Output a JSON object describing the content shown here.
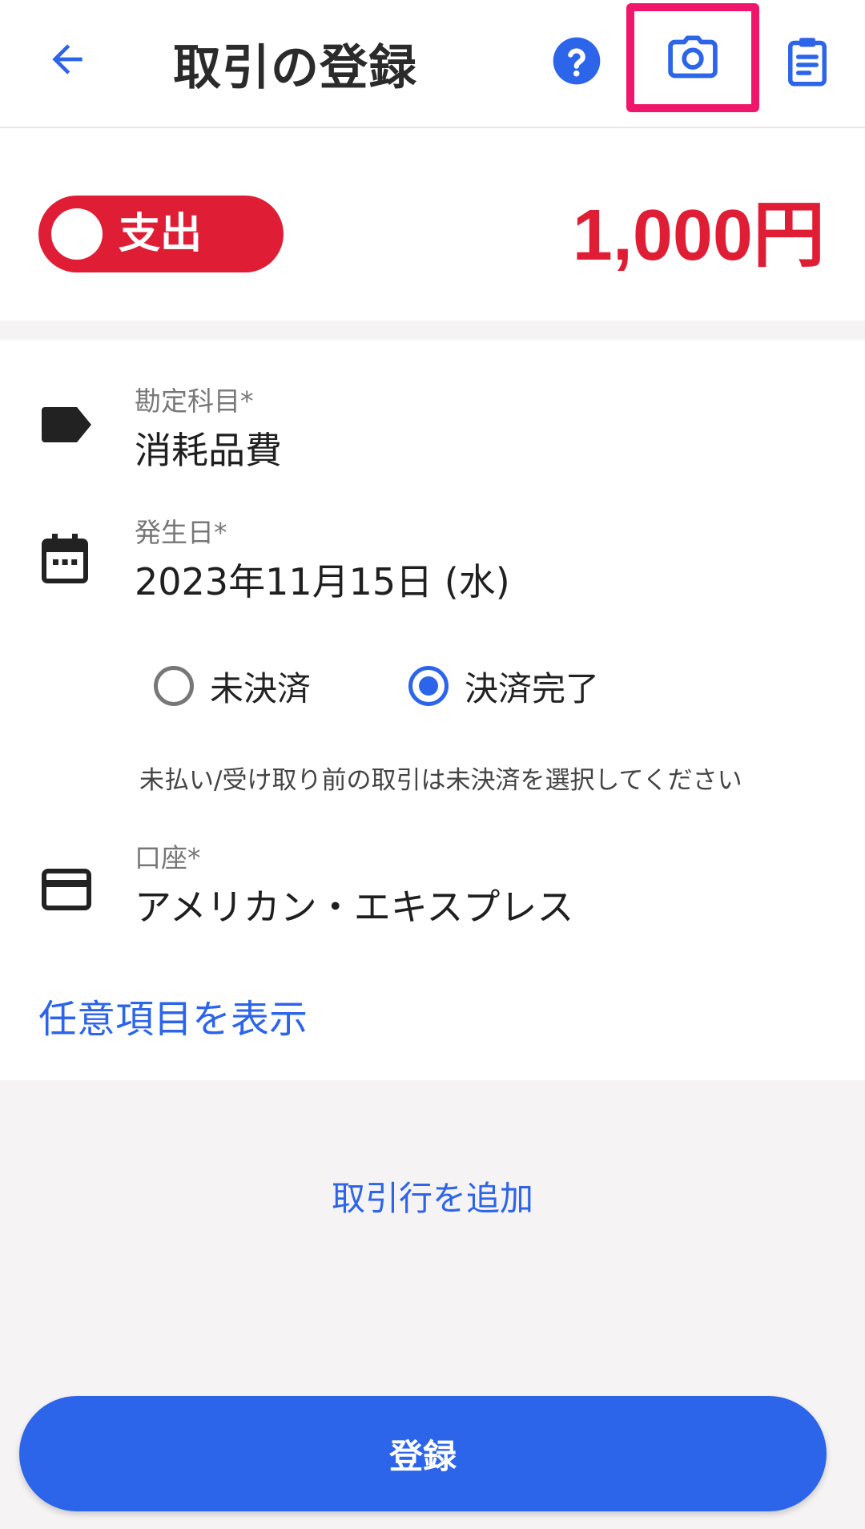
{
  "header": {
    "title": "取引の登録",
    "icons": {
      "back": "arrow-left-icon",
      "help": "question-circle-icon",
      "camera": "camera-icon",
      "clipboard": "clipboard-icon"
    }
  },
  "transaction": {
    "type_label": "支出",
    "amount": "1,000円"
  },
  "fields": {
    "account_item": {
      "label": "勘定科目*",
      "value": "消耗品費"
    },
    "date": {
      "label": "発生日*",
      "value": "2023年11月15日 (水)"
    },
    "settlement": {
      "options": [
        {
          "label": "未決済",
          "checked": false
        },
        {
          "label": "決済完了",
          "checked": true
        }
      ],
      "hint": "未払い/受け取り前の取引は未決済を選択してください"
    },
    "wallet": {
      "label": "口座*",
      "value": "アメリカン・エキスプレス"
    }
  },
  "links": {
    "show_optional": "任意項目を表示",
    "add_line": "取引行を追加"
  },
  "submit": {
    "label": "登録"
  },
  "colors": {
    "primary_blue": "#2c64ea",
    "expense_red": "#df1e36",
    "highlight_pink": "#f0166c"
  }
}
